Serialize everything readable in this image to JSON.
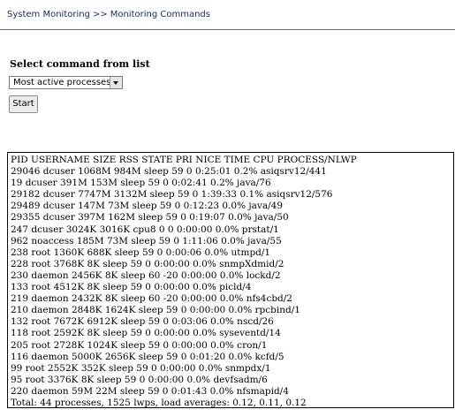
{
  "breadcrumb": {
    "parent": "System Monitoring",
    "separator": ">>",
    "current": "Monitoring Commands"
  },
  "command_form": {
    "label": "Select command from list",
    "selected_command": "Most active processes",
    "start_label": "Start"
  },
  "output": {
    "header": "PID USERNAME SIZE RSS STATE PRI NICE TIME CPU PROCESS/NLWP",
    "rows": [
      "29046 dcuser 1068M 984M sleep 59 0 0:25:01 0.2% asiqsrv12/441",
      "19 dcuser 391M 153M sleep 59 0 0:02:41 0.2% java/76",
      "29182 dcuser 7747M 3132M sleep 59 0 1:39:33 0.1% asiqsrv12/576",
      "29489 dcuser 147M 73M sleep 59 0 0:12:23 0.0% java/49",
      "29355 dcuser 397M 162M sleep 59 0 0:19:07 0.0% java/50",
      "247 dcuser 3024K 3016K cpu8 0 0 0:00:00 0.0% prstat/1",
      "962 noaccess 185M 73M sleep 59 0 1:11:06 0.0% java/55",
      "238 root 1360K 688K sleep 59 0 0:00:06 0.0% utmpd/1",
      "228 root 3768K 8K sleep 59 0 0:00:00 0.0% snmpXdmid/2",
      "230 daemon 2456K 8K sleep 60 -20 0:00:00 0.0% lockd/2",
      "133 root 4512K 8K sleep 59 0 0:00:00 0.0% picld/4",
      "219 daemon 2432K 8K sleep 60 -20 0:00:00 0.0% nfs4cbd/2",
      "210 daemon 2848K 1624K sleep 59 0 0:00:00 0.0% rpcbind/1",
      "132 root 7672K 6912K sleep 59 0 0:03:06 0.0% nscd/26",
      "118 root 2592K 8K sleep 59 0 0:00:00 0.0% syseventd/14",
      "205 root 2728K 1024K sleep 59 0 0:00:00 0.0% cron/1",
      "116 daemon 5000K 2656K sleep 59 0 0:01:20 0.0% kcfd/5",
      "99 root 2552K 352K sleep 59 0 0:00:00 0.0% snmpdx/1",
      "95 root 3376K 8K sleep 59 0 0:00:00 0.0% devfsadm/6",
      "220 daemon 59M 22M sleep 59 0 0:01:43 0.0% nfsmapid/4"
    ],
    "footer": "Total: 44 processes, 1525 lwps, load averages: 0.12, 0.11, 0.12"
  }
}
